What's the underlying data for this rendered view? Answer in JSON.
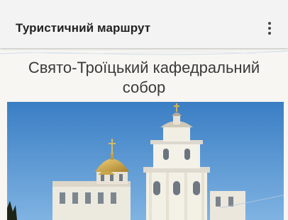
{
  "toolbar": {
    "title": "Туристичний маршрут",
    "menu_icon": "more-vert-icon"
  },
  "main": {
    "title": "Свято-Троїцький кафедральний собор",
    "image": "cathedral-photo"
  },
  "colors": {
    "toolbar_bg": "#f3f3f3",
    "content_bg": "#f7f6f3",
    "sky": "#3f82c6",
    "dome_gold": "#c9a54a"
  }
}
